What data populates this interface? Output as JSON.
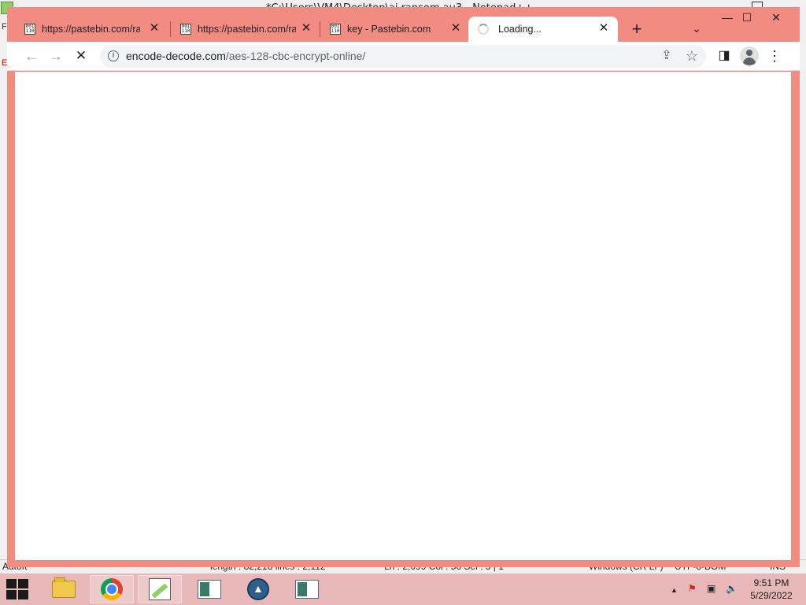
{
  "background_window": {
    "title": "*C:\\Users\\VM4\\Desktop\\ai ransom.au3 - Notepad++",
    "left_strip_chars": [
      "F",
      "E"
    ],
    "statusbar": {
      "language": "AutoIt",
      "length": "length : 82,218    lines : 2,112",
      "position": "Ln : 2,099    Col : 56    Sel : 3 | 1",
      "eol": "Windows (CR LF)",
      "encoding": "UTF-8-BOM",
      "mode": "INS"
    }
  },
  "browser": {
    "tabs": [
      {
        "title": "https://pastebin.com/raw/",
        "favicon": "pastebin-raw-icon",
        "active": false
      },
      {
        "title": "https://pastebin.com/raw/",
        "favicon": "pastebin-raw-icon",
        "active": false
      },
      {
        "title": "key - Pastebin.com",
        "favicon": "pastebin-raw-icon",
        "active": false
      },
      {
        "title": "Loading...",
        "favicon": "loading-spinner-icon",
        "active": true
      }
    ],
    "new_tab_symbol": "+",
    "tab_search_symbol": "⌄",
    "window_controls": {
      "minimize": "—",
      "maximize": "☐",
      "close": "✕"
    },
    "nav": {
      "back": "←",
      "forward": "→",
      "stop": "✕"
    },
    "address_bar": {
      "host": "encode-decode.com",
      "path": "/aes-128-cbc-encrypt-online/"
    },
    "toolbar_icons": {
      "share": "⇪",
      "bookmark": "☆",
      "side_panel": "◨",
      "menu": "⋮"
    }
  },
  "taskbar": {
    "apps": [
      {
        "name": "file-explorer",
        "pinned": true
      },
      {
        "name": "google-chrome",
        "pinned": true
      },
      {
        "name": "notepad-plus-plus",
        "pinned": true
      },
      {
        "name": "document-app",
        "pinned": false
      },
      {
        "name": "autoit",
        "pinned": false
      },
      {
        "name": "document-app-2",
        "pinned": false
      }
    ],
    "tray": {
      "overflow": "▲"
    },
    "clock": {
      "time": "9:51 PM",
      "date": "5/29/2022"
    }
  }
}
